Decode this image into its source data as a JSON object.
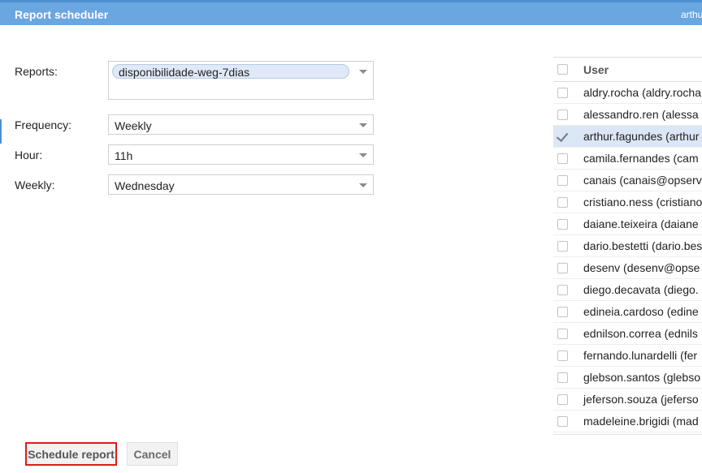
{
  "window": {
    "title": "Report scheduler",
    "user": "arthur"
  },
  "form": {
    "reports": {
      "label": "Reports:",
      "chip": "disponibilidade-weg-7dias"
    },
    "frequency": {
      "label": "Frequency:",
      "value": "Weekly"
    },
    "hour": {
      "label": "Hour:",
      "value": "11h"
    },
    "weekly": {
      "label": "Weekly:",
      "value": "Wednesday"
    }
  },
  "users": {
    "header": "User",
    "rows": [
      {
        "text": "aldry.rocha (aldry.rocha",
        "checked": false
      },
      {
        "text": "alessandro.ren (alessa",
        "checked": false
      },
      {
        "text": "arthur.fagundes (arthur",
        "checked": true
      },
      {
        "text": "camila.fernandes (cam",
        "checked": false
      },
      {
        "text": "canais (canais@opserv",
        "checked": false
      },
      {
        "text": "cristiano.ness (cristiano",
        "checked": false
      },
      {
        "text": "daiane.teixeira (daiane",
        "checked": false
      },
      {
        "text": "dario.bestetti (dario.bes",
        "checked": false
      },
      {
        "text": "desenv (desenv@opse",
        "checked": false
      },
      {
        "text": "diego.decavata (diego.",
        "checked": false
      },
      {
        "text": "edineia.cardoso (edine",
        "checked": false
      },
      {
        "text": "ednilson.correa (ednils",
        "checked": false
      },
      {
        "text": "fernando.lunardelli (fer",
        "checked": false
      },
      {
        "text": "glebson.santos (glebso",
        "checked": false
      },
      {
        "text": "jeferson.souza (jeferso",
        "checked": false
      },
      {
        "text": "madeleine.brigidi (mad",
        "checked": false
      }
    ]
  },
  "actions": {
    "schedule": "Schedule report",
    "cancel": "Cancel"
  }
}
